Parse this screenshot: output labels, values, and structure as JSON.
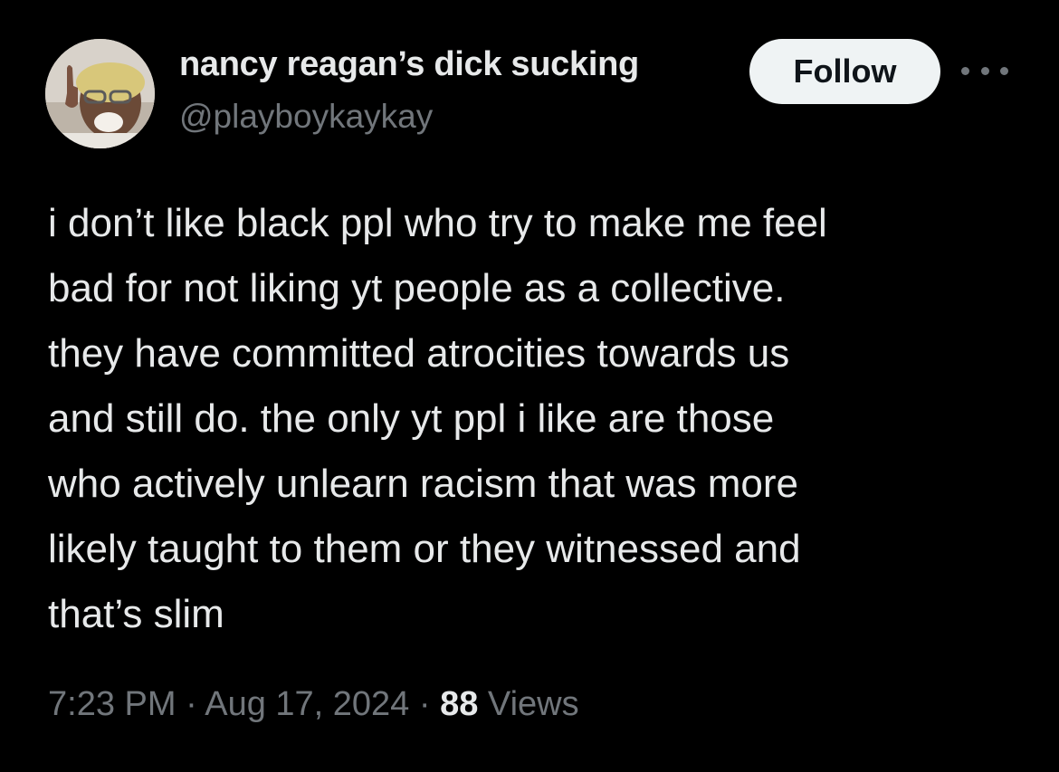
{
  "author": {
    "display_name": "nancy reagan’s dick sucking",
    "handle": "@playboykaykay"
  },
  "actions": {
    "follow_label": "Follow",
    "more_icon": "more-horizontal-icon"
  },
  "tweet": {
    "lines": [
      "i don’t like black ppl who try to make me feel",
      "bad for not liking yt people as a collective.",
      "they have committed atrocities towards us",
      "and still do. the only yt ppl i like are those",
      "who actively unlearn racism that was more",
      "likely taught to them or they witnessed and",
      "that’s slim"
    ]
  },
  "meta": {
    "time": "7:23 PM",
    "separator": " · ",
    "date": "Aug 17, 2024",
    "views_count": "88",
    "views_label": " Views"
  },
  "colors": {
    "background": "#000000",
    "primary_text": "#e7e9ea",
    "secondary_text": "#71767b",
    "follow_bg": "#eff3f4",
    "follow_text": "#0f1419"
  }
}
